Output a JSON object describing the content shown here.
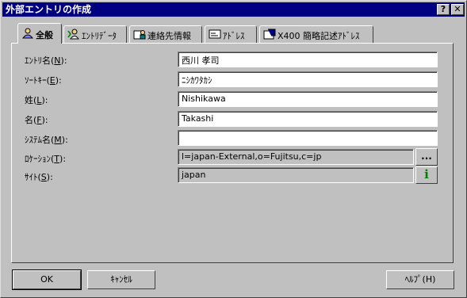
{
  "window": {
    "title": "外部エントリの作成",
    "help_glyph": "?",
    "close_glyph": "✕"
  },
  "tabs": [
    {
      "label": "全般",
      "icon": "person-icon",
      "active": true
    },
    {
      "label": "ｴﾝﾄﾘﾃﾞｰﾀ",
      "icon": "entry-data-icon"
    },
    {
      "label": "連絡先情報",
      "icon": "contact-info-icon"
    },
    {
      "label": "ｱﾄﾞﾚｽ",
      "icon": "address-card-icon"
    },
    {
      "label": "X400 簡略記述ｱﾄﾞﾚｽ",
      "icon": "x400-icon"
    }
  ],
  "form": {
    "entry_name": {
      "label": "ｴﾝﾄﾘ名",
      "key": "N",
      "value": "西川 孝司"
    },
    "sort_key": {
      "label": "ｿｰﾄｷｰ",
      "key": "E",
      "value": "ﾆｼｶﾜﾀｶｼ"
    },
    "surname": {
      "label": "姓",
      "key": "L",
      "value": "Nishikawa"
    },
    "given_name": {
      "label": "名",
      "key": "F",
      "value": "Takashi"
    },
    "system_name": {
      "label": "ｼｽﾃﾑ名",
      "key": "M",
      "value": ""
    },
    "location": {
      "label": "ﾛｹｰｼｮﾝ",
      "key": "T",
      "value": "l=japan-External,o=Fujitsu,c=jp"
    },
    "site": {
      "label": "ｻｲﾄ",
      "key": "S",
      "value": "japan"
    }
  },
  "buttons": {
    "ok": "OK",
    "cancel": "ｷｬﾝｾﾙ",
    "help": "ﾍﾙﾌﾟ(H)",
    "browse": "...",
    "info": "i"
  },
  "colors": {
    "titlebar": "#000080",
    "face": "#c0c0c0",
    "info": "#008000"
  }
}
